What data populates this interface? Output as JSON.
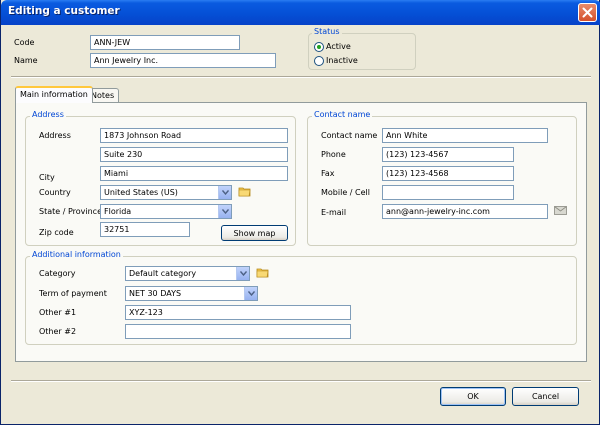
{
  "window": {
    "title": "Editing a customer"
  },
  "header": {
    "code_label": "Code",
    "code_value": "ANN-JEW",
    "name_label": "Name",
    "name_value": "Ann Jewelry Inc.",
    "status_label": "Status",
    "status_active": "Active",
    "status_inactive": "Inactive",
    "status_selected": "Active"
  },
  "tabs": [
    {
      "label": "Main information",
      "active": true
    },
    {
      "label": "Notes",
      "active": false
    }
  ],
  "address": {
    "group_label": "Address",
    "address_label": "Address",
    "address_line1": "1873 Johnson Road",
    "address_line2": "Suite 230",
    "city_label": "City",
    "city_value": "Miami",
    "country_label": "Country",
    "country_value": "United States (US)",
    "state_label": "State / Province",
    "state_value": "Florida",
    "zip_label": "Zip code",
    "zip_value": "32751",
    "show_map_label": "Show map"
  },
  "contact": {
    "group_label": "Contact name",
    "contact_label": "Contact name",
    "contact_value": "Ann White",
    "phone_label": "Phone",
    "phone_value": "(123) 123-4567",
    "fax_label": "Fax",
    "fax_value": "(123) 123-4568",
    "mobile_label": "Mobile / Cell",
    "mobile_value": "",
    "email_label": "E-mail",
    "email_value": "ann@ann-jewelry-inc.com"
  },
  "additional": {
    "group_label": "Additional information",
    "category_label": "Category",
    "category_value": "Default category",
    "term_label": "Term of payment",
    "term_value": "NET 30 DAYS",
    "other1_label": "Other #1",
    "other1_value": "XYZ-123",
    "other2_label": "Other #2",
    "other2_value": ""
  },
  "footer": {
    "ok_label": "OK",
    "cancel_label": "Cancel"
  },
  "icons": {
    "folder": "folder-icon",
    "envelope": "envelope-icon",
    "close": "close-icon"
  },
  "colors": {
    "title_bar": "#0550D6",
    "group_label": "#0046D5",
    "radio_dot": "#21A121"
  }
}
